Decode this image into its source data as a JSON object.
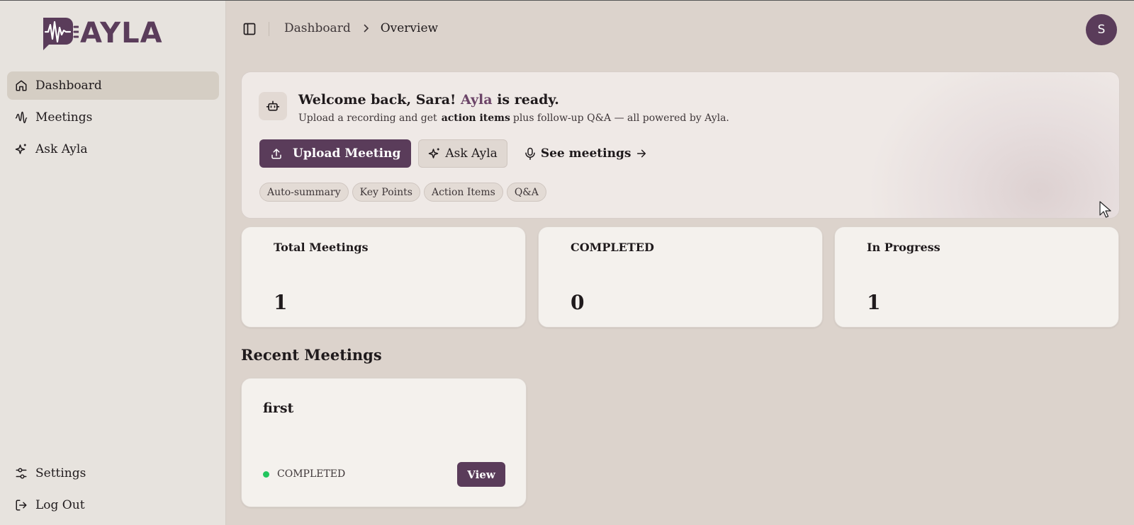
{
  "app": {
    "brand": "AYLA",
    "brand_color": "#5a3c5a"
  },
  "sidebar": {
    "items": [
      {
        "label": "Dashboard",
        "icon": "home-icon",
        "active": true
      },
      {
        "label": "Meetings",
        "icon": "audio-wave-icon",
        "active": false
      },
      {
        "label": "Ask Ayla",
        "icon": "sparkles-icon",
        "active": false
      }
    ],
    "bottom_items": [
      {
        "label": "Settings",
        "icon": "sliders-icon"
      },
      {
        "label": "Log Out",
        "icon": "log-out-icon"
      }
    ]
  },
  "header": {
    "breadcrumb": [
      "Dashboard",
      "Overview"
    ],
    "avatar_initial": "S"
  },
  "welcome": {
    "title_prefix": "Welcome back, Sara!",
    "title_brand": "Ayla",
    "title_suffix": "is ready.",
    "subtitle_prefix": "Upload a recording and get",
    "subtitle_bold": "action items",
    "subtitle_suffix": "plus follow-up Q&A — all powered by Ayla.",
    "upload_label": "Upload Meeting",
    "ask_label": "Ask Ayla",
    "see_label": "See meetings",
    "chips": [
      "Auto-summary",
      "Key Points",
      "Action Items",
      "Q&A"
    ]
  },
  "stats": [
    {
      "label": "Total Meetings",
      "value": "1"
    },
    {
      "label": "COMPLETED",
      "value": "0"
    },
    {
      "label": "In Progress",
      "value": "1"
    }
  ],
  "recent": {
    "title": "Recent Meetings",
    "meetings": [
      {
        "title": "first",
        "status": "COMPLETED",
        "status_color": "#22c55e",
        "action": "View"
      }
    ]
  }
}
